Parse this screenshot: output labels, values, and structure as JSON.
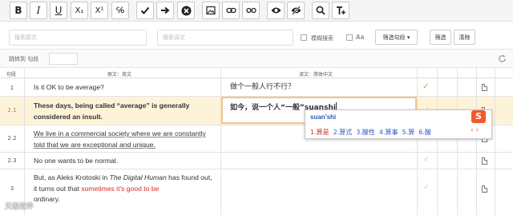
{
  "toolbar": {
    "buttons": [
      {
        "name": "bold",
        "label": "B"
      },
      {
        "name": "italic",
        "label": "I"
      },
      {
        "name": "underline",
        "label": "U"
      },
      {
        "name": "subscript",
        "label": "X₁"
      },
      {
        "name": "superscript",
        "label": "X¹"
      },
      {
        "name": "special-chars",
        "label": "℅"
      }
    ]
  },
  "filter": {
    "source_placeholder": "搜索原文",
    "target_placeholder": "搜索译文",
    "fuzzy_label": "模糊搜索",
    "case_label": "Aa",
    "filter_dropdown": "筛选句段 ▾",
    "filter_button": "筛选",
    "clear_button": "清除"
  },
  "jump": {
    "label": "跳转到 句段"
  },
  "grid": {
    "headers": {
      "index": "句段",
      "source": "原文：英文",
      "target": "译文：简体中文"
    },
    "rows": [
      {
        "index": "1",
        "source": "Is it OK to be average?",
        "target": "做个一般人行不行？"
      },
      {
        "index": "2.1",
        "source": "These days, being called “average” is generally considered an insult.",
        "target_prefix": "如今，说一个人“一般”",
        "target_composing": "suanshi"
      },
      {
        "index": "2.2",
        "source": "We live in a commercial society where we are constantly told that we are exceptional and unique.",
        "target": ""
      },
      {
        "index": "2.3",
        "source": "No one wants to be normal.",
        "target": ""
      },
      {
        "index": "3",
        "source_part1": "But, as Aleks Krotoski in ",
        "source_italic": "The Digital Human",
        "source_part2": " has found out, it turns out that ",
        "source_red": "sometimes it's good to be",
        "source_part3": "ordinary.",
        "target": ""
      }
    ]
  },
  "ime": {
    "composition": "suan'shi",
    "candidates": [
      "1.算是",
      "2.算式",
      "3.酸性",
      "4.算事",
      "5.算",
      "6.酸"
    ],
    "logo": "S",
    "arrows": "‹ ›"
  },
  "watermark": "天极软件",
  "colors": {
    "accent_yellow": "#d9a32a",
    "active_row": "#fdf3d9",
    "ime_blue": "#2b5cc4",
    "ime_red": "#d62a2a",
    "sogou_orange": "#f05a28"
  }
}
